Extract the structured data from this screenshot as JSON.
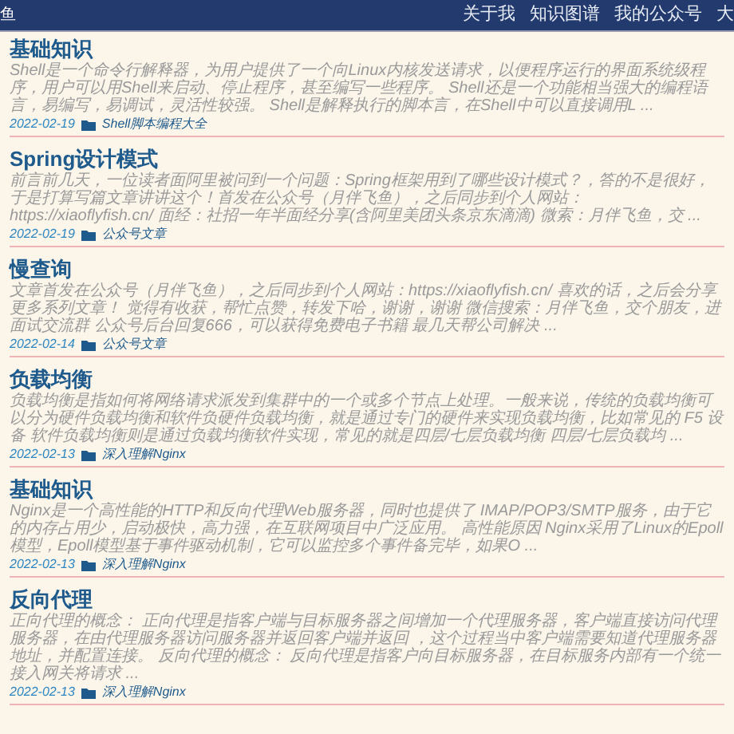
{
  "header": {
    "logo_text": "鱼",
    "nav": [
      "关于我",
      "知识图谱",
      "我的公众号",
      "大"
    ]
  },
  "posts": [
    {
      "title": "基础知识",
      "excerpt": "Shell是一个命令行解释器，为用户提供了一个向Linux内核发送请求，以便程序运行的界面系统级程序，用户可以用Shell来启动、停止程序，甚至编写一些程序。 Shell还是一个功能相当强大的编程语言，易编写，易调试，灵活性较强。 Shell是解释执行的脚本言，在Shell中可以直接调用L ...",
      "date": "2022-02-19",
      "category": "Shell脚本编程大全"
    },
    {
      "title": "Spring设计模式",
      "excerpt": "前言前几天，一位读者面阿里被问到一个问题：Spring框架用到了哪些设计模式？，答的不是很好，于是打算写篇文章讲讲这个！首发在公众号（月伴飞鱼），之后同步到个人网站：https://xiaoflyfish.cn/ 面经：社招一年半面经分享(含阿里美团头条京东滴滴) 微索：月伴飞鱼，交 ...",
      "date": "2022-02-19",
      "category": "公众号文章"
    },
    {
      "title": "慢查询",
      "excerpt": "文章首发在公众号（月伴飞鱼），之后同步到个人网站：https://xiaoflyfish.cn/ 喜欢的话，之后会分享更多系列文章！ 觉得有收获，帮忙点赞，转发下哈，谢谢，谢谢 微信搜索：月伴飞鱼，交个朋友，进面试交流群 公众号后台回复666，可以获得免费电子书籍 最几天帮公司解决 ...",
      "date": "2022-02-14",
      "category": "公众号文章"
    },
    {
      "title": "负载均衡",
      "excerpt": "负载均衡是指如何将网络请求派发到集群中的一个或多个节点上处理。一般来说，传统的负载均衡可以分为硬件负载均衡和软件负硬件负载均衡，就是通过专门的硬件来实现负载均衡，比如常见的 F5 设备 软件负载均衡则是通过负载均衡软件实现，常见的就是四层/七层负载均衡 四层/七层负载均 ...",
      "date": "2022-02-13",
      "category": "深入理解Nginx"
    },
    {
      "title": "基础知识",
      "excerpt": "Nginx是一个高性能的HTTP和反向代理Web服务器，同时也提供了 IMAP/POP3/SMTP服务，由于它的内存占用少，启动极快，高力强，在互联网项目中广泛应用。 高性能原因 Nginx采用了Linux的Epoll模型，Epoll模型基于事件驱动机制，它可以监控多个事件备完毕，如果O ...",
      "date": "2022-02-13",
      "category": "深入理解Nginx"
    },
    {
      "title": "反向代理",
      "excerpt": "正向代理的概念： 正向代理是指客户端与目标服务器之间增加一个代理服务器，客户端直接访问代理服务器，在由代理服务器访问服务器并返回客户端并返回 ，这个过程当中客户端需要知道代理服务器地址，并配置连接。 反向代理的概念： 反向代理是指客户向目标服务器，在目标服务内部有一个统一接入网关将请求 ...",
      "date": "2022-02-13",
      "category": "深入理解Nginx"
    }
  ]
}
